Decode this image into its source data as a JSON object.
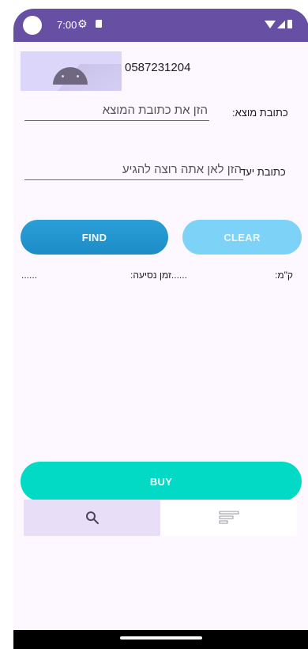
{
  "status_bar": {
    "time": "7:00",
    "icons": [
      "settings-icon",
      "sd-card-icon",
      "wifi-icon",
      "signal-icon",
      "battery-icon"
    ]
  },
  "profile": {
    "phone_number": "0587231204",
    "image": "android-placeholder"
  },
  "origin": {
    "label": "כתובת מוצא:",
    "placeholder": "הזן את כתובת המוצא"
  },
  "destination": {
    "label": "כתובת יעד",
    "placeholder": "הזן לאן אתה רוצה להגיע"
  },
  "buttons": {
    "find": "FIND",
    "clear": "CLEAR",
    "buy": "BUY"
  },
  "trip_info": {
    "km_label": "ק\"מ:",
    "time_label": "......זמן נסיעה:",
    "price_label": "......"
  },
  "bottom_nav": [
    {
      "icon": "search-icon",
      "active": true
    },
    {
      "icon": "list-icon",
      "active": false
    }
  ],
  "colors": {
    "status_bar": "#6750a4",
    "find": "#1d8cc6",
    "clear": "#7dd2f8",
    "buy": "#03dac5",
    "nav_active": "#e8def8"
  }
}
